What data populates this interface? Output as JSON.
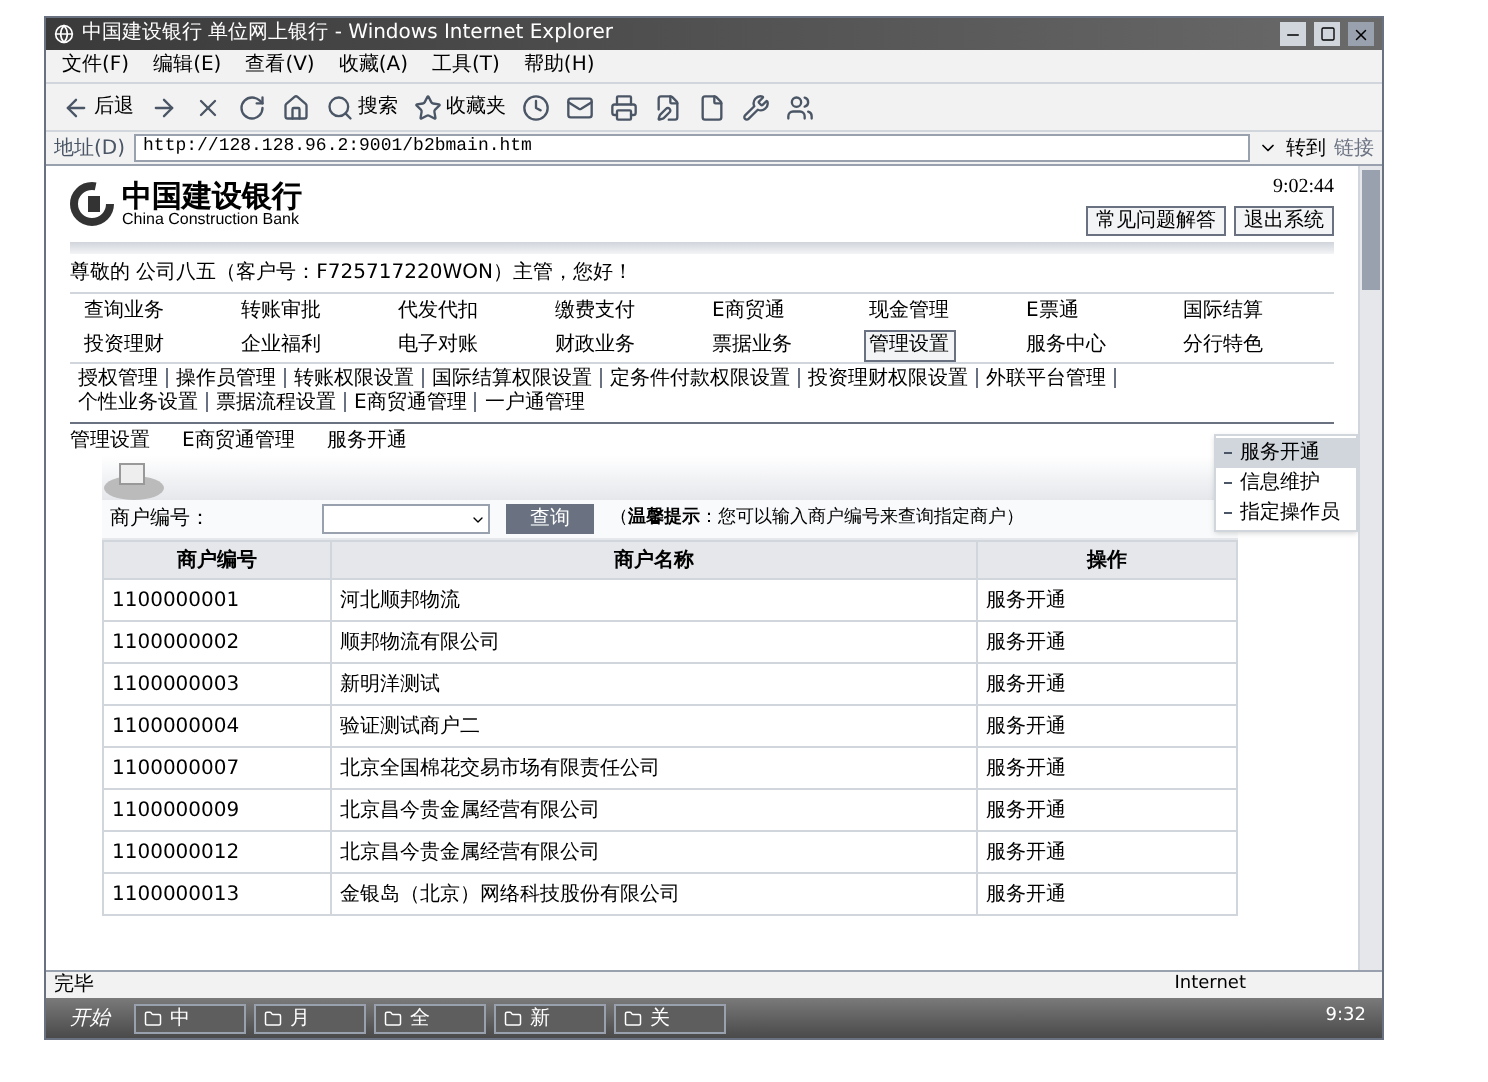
{
  "window": {
    "title": "中国建设银行 单位网上银行 - Windows Internet Explorer"
  },
  "menu_bar": [
    "文件(F)",
    "编辑(E)",
    "查看(V)",
    "收藏(A)",
    "工具(T)",
    "帮助(H)"
  ],
  "toolbar": [
    {
      "kind": "back",
      "label": "后退"
    },
    {
      "kind": "forward"
    },
    {
      "kind": "stop"
    },
    {
      "kind": "refresh"
    },
    {
      "kind": "home"
    },
    {
      "kind": "search",
      "label": "搜索"
    },
    {
      "kind": "favorites",
      "label": "收藏夹"
    },
    {
      "kind": "history"
    },
    {
      "kind": "mail"
    },
    {
      "kind": "print"
    },
    {
      "kind": "edit"
    },
    {
      "kind": "page"
    },
    {
      "kind": "tools"
    },
    {
      "kind": "messenger"
    }
  ],
  "address_bar": {
    "label": "地址(D)",
    "url": "http://128.128.96.2:9001/b2bmain.htm",
    "go": "转到",
    "links": "链接"
  },
  "page": {
    "logo": {
      "name": "中国建设银行",
      "english": "China Construction Bank"
    },
    "time": "9:02:44",
    "header_buttons": [
      "常见问题解答",
      "退出系统"
    ],
    "welcome": "尊敬的 公司八五（客户号：F725717220WON）主管，您好！",
    "nav": [
      {
        "label": "查询业务",
        "selected": false
      },
      {
        "label": "转账审批",
        "selected": false
      },
      {
        "label": "代发代扣",
        "selected": false
      },
      {
        "label": "缴费支付",
        "selected": false
      },
      {
        "label": "E商贸通",
        "selected": false
      },
      {
        "label": "现金管理",
        "selected": false
      },
      {
        "label": "E票通",
        "selected": false
      },
      {
        "label": "国际结算",
        "selected": false
      },
      {
        "label": "投资理财",
        "selected": false
      },
      {
        "label": "企业福利",
        "selected": false
      },
      {
        "label": "电子对账",
        "selected": false
      },
      {
        "label": "财政业务",
        "selected": false
      },
      {
        "label": "票据业务",
        "selected": false
      },
      {
        "label": "管理设置",
        "selected": true
      },
      {
        "label": "服务中心",
        "selected": false
      },
      {
        "label": "分行特色",
        "selected": false
      }
    ],
    "sub_nav": [
      "授权管理",
      "操作员管理",
      "转账权限设置",
      "国际结算权限设置",
      "定务件付款权限设置",
      "投资理财权限设置",
      "外联平台管理",
      "个性业务设置",
      "票据流程设置",
      "E商贸通管理",
      "一户通管理"
    ],
    "breadcrumb": [
      "管理设置",
      "E商贸通管理",
      "服务开通"
    ],
    "side_menu": [
      {
        "label": "服务开通",
        "selected": true
      },
      {
        "label": "信息维护",
        "selected": false
      },
      {
        "label": "指定操作员",
        "selected": false
      }
    ],
    "search": {
      "label": "商户编号：",
      "button": "查询",
      "hint": "（**温馨提示**：您可以输入商户编号来查询指定商户）"
    },
    "table": {
      "columns": [
        "商户编号",
        "商户名称",
        "操作"
      ],
      "rows": [
        [
          "1100000001",
          "河北顺邦物流",
          "服务开通"
        ],
        [
          "1100000002",
          "顺邦物流有限公司",
          "服务开通"
        ],
        [
          "1100000003",
          "新明洋测试",
          "服务开通"
        ],
        [
          "1100000004",
          "验证测试商户二",
          "服务开通"
        ],
        [
          "1100000007",
          "北京全国棉花交易市场有限责任公司",
          "服务开通"
        ],
        [
          "1100000009",
          "北京昌今贵金属经营有限公司",
          "服务开通"
        ],
        [
          "1100000012",
          "北京昌今贵金属经营有限公司",
          "服务开通"
        ],
        [
          "1100000013",
          "金银岛（北京）网络科技股份有限公司",
          "服务开通"
        ]
      ]
    }
  },
  "status_bar": {
    "status": "完毕",
    "zone": "Internet"
  },
  "taskbar": {
    "start": "开始",
    "tasks": [
      "中",
      "月",
      "全",
      "新",
      "关"
    ],
    "clock": "9:32"
  }
}
